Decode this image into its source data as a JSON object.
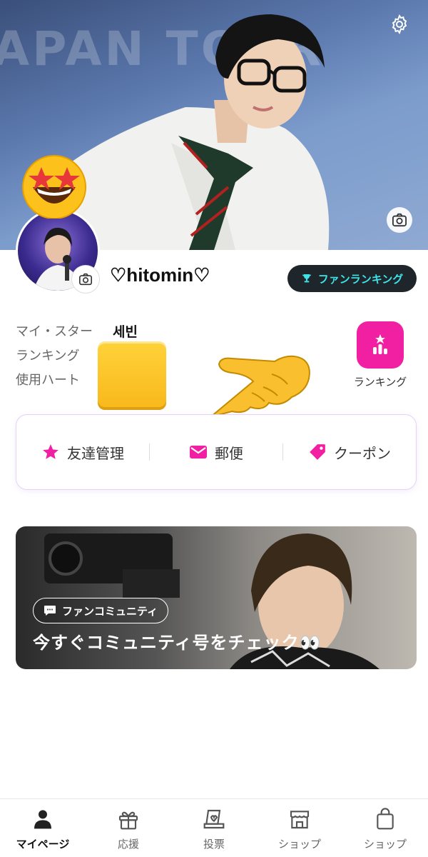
{
  "cover": {
    "banner_text": "APAN TOUR",
    "settings_icon": "gear-icon",
    "camera_icon": "camera-icon"
  },
  "profile": {
    "avatar_camera_icon": "camera-icon",
    "decoration_emoji": "star-struck-emoji",
    "username": "♡hitomin♡"
  },
  "fan_ranking_button": {
    "label": "ファンランキング",
    "icon": "trophy-icon",
    "text_color": "#3ee3e8",
    "bg_color": "#1e252b"
  },
  "stats": {
    "my_star_label": "マイ・スター",
    "my_star_value": "세빈",
    "ranking_label": "ランキング",
    "hearts_label": "使用ハート"
  },
  "ranking_shortcut": {
    "label": "ランキング",
    "icon": "bar-chart-icon",
    "bg_color": "#f11fa2"
  },
  "actions": [
    {
      "label": "友達管理",
      "icon": "star-icon"
    },
    {
      "label": "郵便",
      "icon": "mail-icon"
    },
    {
      "label": "クーポン",
      "icon": "tag-icon"
    }
  ],
  "accent_color": "#f11fa2",
  "community": {
    "badge": "ファンコミュニティ",
    "title": "今すぐコミュニティ号をチェック👀"
  },
  "nav": {
    "items": [
      {
        "label": "マイページ",
        "icon": "person-icon",
        "active": true
      },
      {
        "label": "応援",
        "icon": "gift-icon",
        "active": false
      },
      {
        "label": "投票",
        "icon": "vote-icon",
        "active": false
      },
      {
        "label": "ショップ",
        "icon": "store-icon",
        "active": false
      },
      {
        "label": "ショップ",
        "icon": "shopping-bag-icon",
        "active": false
      }
    ]
  }
}
